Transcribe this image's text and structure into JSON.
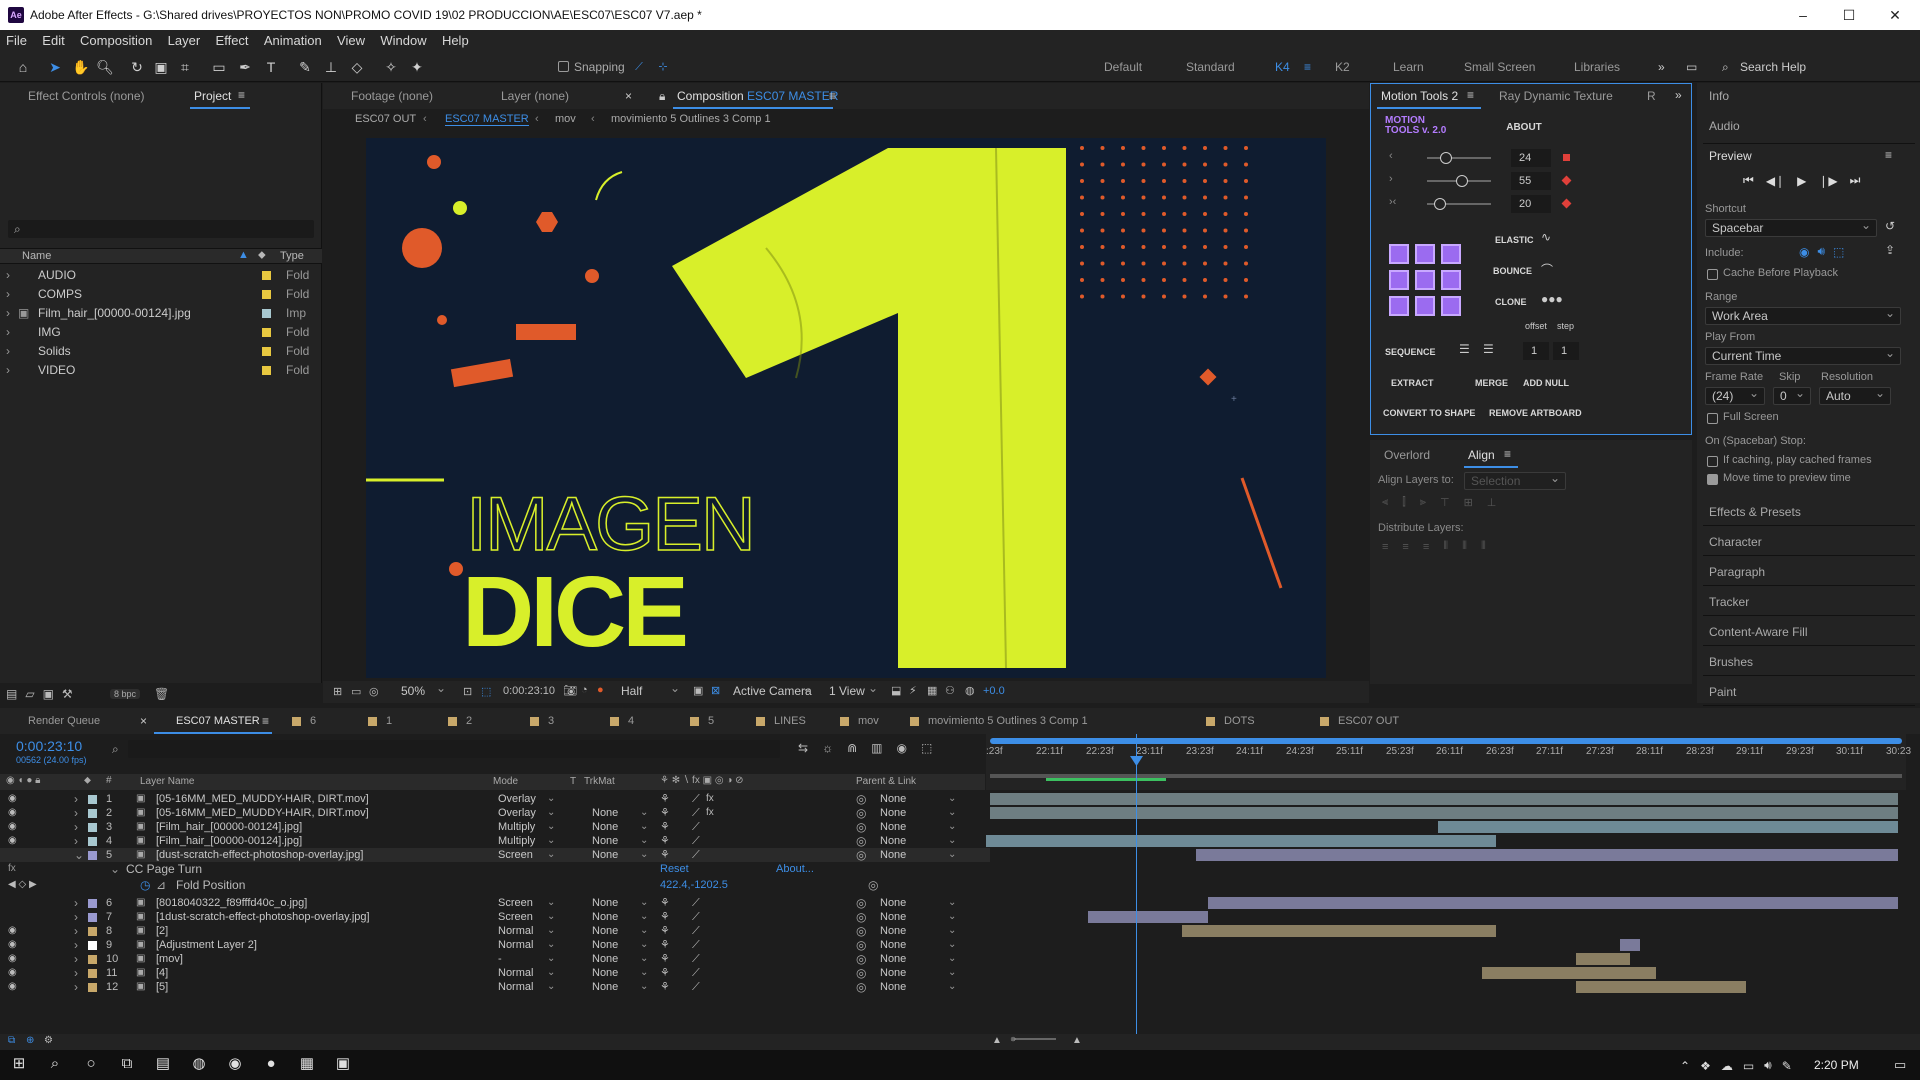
{
  "window": {
    "app_icon": "Ae",
    "title": "Adobe After Effects - G:\\Shared drives\\PROYECTOS NON\\PROMO COVID 19\\02 PRODUCCION\\AE\\ESC07\\ESC07 V7.aep *",
    "minimize": "–",
    "maximize": "☐",
    "close": "✕"
  },
  "menu": [
    "File",
    "Edit",
    "Composition",
    "Layer",
    "Effect",
    "Animation",
    "View",
    "Window",
    "Help"
  ],
  "toolbar": {
    "snapping_label": "Snapping",
    "workspaces": [
      "Default",
      "Standard",
      "K4",
      "K2",
      "Learn",
      "Small Screen",
      "Libraries"
    ],
    "active_workspace": "K4",
    "search_placeholder": "Search Help",
    "more": "»"
  },
  "left_panel": {
    "tabs": [
      "Effect Controls (none)",
      "Project"
    ],
    "columns": [
      "Name",
      "Type"
    ],
    "items": [
      {
        "name": "AUDIO",
        "type": "Fold",
        "color": "#e8c840",
        "icon": "folder-icon"
      },
      {
        "name": "COMPS",
        "type": "Fold",
        "color": "#e8c840",
        "icon": "folder-icon"
      },
      {
        "name": "Film_hair_[00000-00124].jpg",
        "type": "Imp",
        "color": "#a8c8d0",
        "icon": "image-sequence-icon"
      },
      {
        "name": "IMG",
        "type": "Fold",
        "color": "#e8c840",
        "icon": "folder-icon"
      },
      {
        "name": "Solids",
        "type": "Fold",
        "color": "#e8c840",
        "icon": "folder-icon"
      },
      {
        "name": "VIDEO",
        "type": "Fold",
        "color": "#e8c840",
        "icon": "folder-icon"
      }
    ],
    "bpc": "8 bpc"
  },
  "viewer": {
    "tabs": [
      "Footage (none)",
      "Layer (none)",
      "Composition ESC07 MASTER"
    ],
    "comp_prefix": "Composition",
    "comp_name": "ESC07 MASTER",
    "breadcrumbs": [
      "ESC07 OUT",
      "ESC07 MASTER",
      "mov",
      "movimiento 5 Outlines 3 Comp 1"
    ],
    "canvas_text_top": "IMAGEN",
    "canvas_text_bottom": "DICE",
    "canvas_bg": "#0f1c30",
    "accent_green": "#d8ef2a",
    "accent_orange": "#e05a2a",
    "zoom": "50%",
    "timecode": "0:00:23:10",
    "resolution": "Half",
    "camera": "Active Camera",
    "views": "1 View",
    "exposure": "+0.0"
  },
  "motion_tools": {
    "tabs": [
      "Motion Tools 2",
      "Ray Dynamic Texture",
      "R"
    ],
    "logo_line1": "MOTION",
    "logo_line2": "TOOLS v. 2.0",
    "about": "ABOUT",
    "sliders": [
      {
        "icon": "‹",
        "value": "24",
        "level": 0.3
      },
      {
        "icon": "›",
        "value": "55",
        "level": 0.55
      },
      {
        "icon": "›‹",
        "value": "20",
        "level": 0.2
      }
    ],
    "buttons": {
      "elastic": "ELASTIC",
      "bounce": "BOUNCE",
      "clone": "CLONE",
      "offset": "offset",
      "step": "step",
      "sequence": "SEQUENCE",
      "seq_value1": "1",
      "seq_value2": "1",
      "extract": "EXTRACT",
      "merge": "MERGE",
      "add_null": "ADD NULL",
      "convert": "CONVERT TO SHAPE",
      "remove_artboard": "REMOVE ARTBOARD"
    }
  },
  "align": {
    "tabs": [
      "Overlord",
      "Align"
    ],
    "align_to_label": "Align Layers to:",
    "align_to_value": "Selection",
    "distribute_label": "Distribute Layers:"
  },
  "right_panel": {
    "sections_top": [
      "Info",
      "Audio"
    ],
    "preview_title": "Preview",
    "shortcut_label": "Shortcut",
    "shortcut_value": "Spacebar",
    "include_label": "Include:",
    "cache_label": "Cache Before Playback",
    "range_label": "Range",
    "range_value": "Work Area",
    "play_from_label": "Play From",
    "play_from_value": "Current Time",
    "frame_rate_label": "Frame Rate",
    "frame_rate_value": "(24)",
    "skip_label": "Skip",
    "skip_value": "0",
    "resolution_label": "Resolution",
    "resolution_value": "Auto",
    "full_screen_label": "Full Screen",
    "stop_label": "On (Spacebar) Stop:",
    "if_caching_label": "If caching, play cached frames",
    "move_time_label": "Move time to preview time",
    "sections_bottom": [
      "Effects & Presets",
      "Character",
      "Paragraph",
      "Tracker",
      "Content-Aware Fill",
      "Brushes",
      "Paint"
    ]
  },
  "timeline": {
    "tabs": [
      "Render Queue",
      "ESC07 MASTER",
      "6",
      "1",
      "2",
      "3",
      "4",
      "5",
      "LINES",
      "mov",
      "movimiento 5 Outlines 3 Comp 1",
      "DOTS",
      "ESC07 OUT"
    ],
    "tab_colors": [
      "",
      "",
      "#c8a86a",
      "#c8a86a",
      "#c8a86a",
      "#c8a86a",
      "#c8a86a",
      "#c8a86a",
      "#c8a86a",
      "#c8a86a",
      "#c8a86a",
      "#c8a86a",
      "#c8a86a"
    ],
    "timecode": "0:00:23:10",
    "frames": "00562 (24.00 fps)",
    "columns": {
      "layer_name": "Layer Name",
      "mode": "Mode",
      "t": "T",
      "trkmat": "TrkMat",
      "parent": "Parent & Link"
    },
    "ruler": [
      ":23f",
      "22:11f",
      "22:23f",
      "23:11f",
      "23:23f",
      "24:11f",
      "24:23f",
      "25:11f",
      "25:23f",
      "26:11f",
      "26:23f",
      "27:11f",
      "27:23f",
      "28:11f",
      "28:23f",
      "29:11f",
      "29:23f",
      "30:11f",
      "30:23"
    ],
    "layers": [
      {
        "num": "1",
        "name": "[05-16MM_MED_MUDDY-HAIR, DIRT.mov]",
        "mode": "Overlay",
        "trk": "",
        "parent": "None",
        "color": "#a8c8d0",
        "fx": true
      },
      {
        "num": "2",
        "name": "[05-16MM_MED_MUDDY-HAIR, DIRT.mov]",
        "mode": "Overlay",
        "trk": "None",
        "parent": "None",
        "color": "#a8c8d0",
        "fx": true
      },
      {
        "num": "3",
        "name": "[Film_hair_[00000-00124].jpg]",
        "mode": "Multiply",
        "trk": "None",
        "parent": "None",
        "color": "#a8c8d0",
        "fx": false
      },
      {
        "num": "4",
        "name": "[Film_hair_[00000-00124].jpg]",
        "mode": "Multiply",
        "trk": "None",
        "parent": "None",
        "color": "#a8c8d0",
        "fx": false
      },
      {
        "num": "5",
        "name": "[dust-scratch-effect-photoshop-overlay.jpg]",
        "mode": "Screen",
        "trk": "None",
        "parent": "None",
        "color": "#9a9ad0",
        "fx": false
      },
      {
        "num": "6",
        "name": "[8018040322_f89fffd40c_o.jpg]",
        "mode": "Screen",
        "trk": "None",
        "parent": "None",
        "color": "#9a9ad0",
        "fx": false
      },
      {
        "num": "7",
        "name": "[1dust-scratch-effect-photoshop-overlay.jpg]",
        "mode": "Screen",
        "trk": "None",
        "parent": "None",
        "color": "#9a9ad0",
        "fx": false
      },
      {
        "num": "8",
        "name": "[2]",
        "mode": "Normal",
        "trk": "None",
        "parent": "None",
        "color": "#c8a86a",
        "fx": false
      },
      {
        "num": "9",
        "name": "[Adjustment Layer 2]",
        "mode": "Normal",
        "trk": "None",
        "parent": "None",
        "color": "#ffffff",
        "fx": false
      },
      {
        "num": "10",
        "name": "[mov]",
        "mode": "-",
        "trk": "None",
        "parent": "None",
        "color": "#c8a86a",
        "fx": false
      },
      {
        "num": "11",
        "name": "[4]",
        "mode": "Normal",
        "trk": "None",
        "parent": "None",
        "color": "#c8a86a",
        "fx": false
      },
      {
        "num": "12",
        "name": "[5]",
        "mode": "Normal",
        "trk": "None",
        "parent": "None",
        "color": "#c8a86a",
        "fx": false
      }
    ],
    "effect": {
      "name": "CC Page Turn",
      "reset": "Reset",
      "about": "About...",
      "property": "Fold Position",
      "value": "422.4,-1202.5"
    }
  },
  "taskbar": {
    "time": "2:20 PM",
    "apps": [
      "start-icon",
      "search-icon",
      "cortana-icon",
      "task-view-icon",
      "file-explorer-icon",
      "chrome-icon",
      "whatsapp-icon",
      "spotify-icon",
      "excel-icon",
      "after-effects-icon"
    ]
  }
}
